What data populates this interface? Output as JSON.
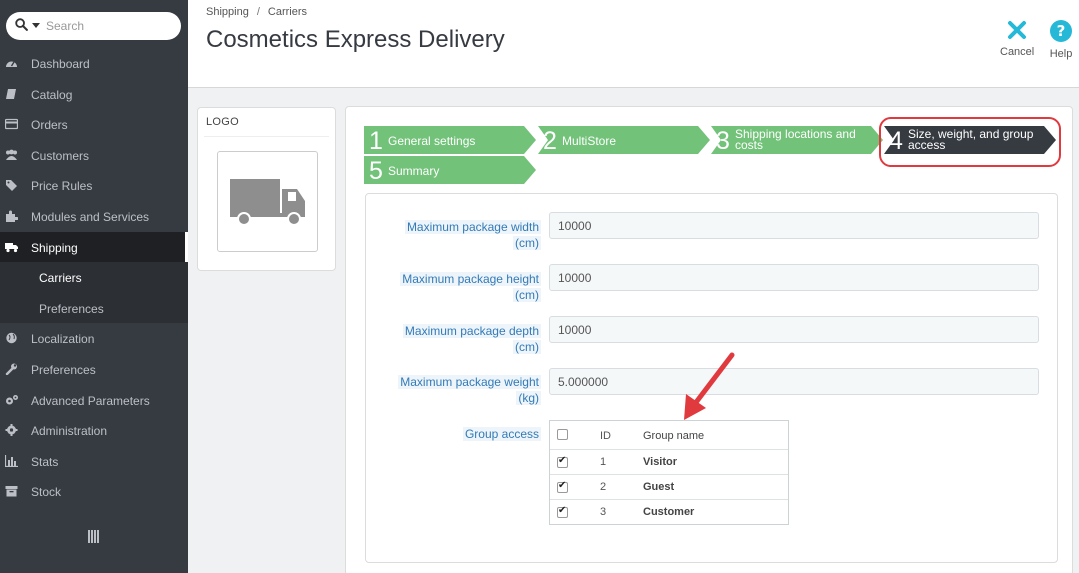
{
  "sidebar": {
    "search_placeholder": "Search",
    "items": [
      {
        "label": "Dashboard",
        "icon": "dashboard-icon"
      },
      {
        "label": "Catalog",
        "icon": "book-icon"
      },
      {
        "label": "Orders",
        "icon": "credit-card-icon"
      },
      {
        "label": "Customers",
        "icon": "users-icon"
      },
      {
        "label": "Price Rules",
        "icon": "tag-icon"
      },
      {
        "label": "Modules and Services",
        "icon": "puzzle-icon"
      },
      {
        "label": "Shipping",
        "icon": "truck-icon",
        "active": true
      }
    ],
    "sub_items": [
      {
        "label": "Carriers",
        "current": true
      },
      {
        "label": "Preferences"
      }
    ],
    "items_after": [
      {
        "label": "Localization",
        "icon": "globe-icon"
      },
      {
        "label": "Preferences",
        "icon": "wrench-icon"
      },
      {
        "label": "Advanced Parameters",
        "icon": "cogs-icon"
      },
      {
        "label": "Administration",
        "icon": "gear-icon"
      },
      {
        "label": "Stats",
        "icon": "bar-chart-icon"
      },
      {
        "label": "Stock",
        "icon": "archive-icon"
      }
    ]
  },
  "header": {
    "breadcrumb": [
      "Shipping",
      "Carriers"
    ],
    "breadcrumb_sep": "/",
    "title": "Cosmetics Express Delivery",
    "cancel_label": "Cancel",
    "help_label": "Help"
  },
  "logo_panel": {
    "title": "LOGO"
  },
  "wizard": {
    "steps": [
      {
        "num": "1",
        "label": "General settings"
      },
      {
        "num": "2",
        "label": "MultiStore"
      },
      {
        "num": "3",
        "label_line1": "Shipping locations and",
        "label_line2": "costs"
      },
      {
        "num": "4",
        "label_line1": "Size, weight, and group",
        "label_line2": "access",
        "current": true
      },
      {
        "num": "5",
        "label": "Summary"
      }
    ]
  },
  "form": {
    "width": {
      "label_line1": "Maximum package width",
      "label_line2": "(cm)",
      "value": "10000"
    },
    "height": {
      "label_line1": "Maximum package height",
      "label_line2": "(cm)",
      "value": "10000"
    },
    "depth": {
      "label_line1": "Maximum package depth",
      "label_line2": "(cm)",
      "value": "10000"
    },
    "weight": {
      "label_line1": "Maximum package weight",
      "label_line2": "(kg)",
      "value": "5.000000"
    },
    "group_access": {
      "label": "Group access",
      "header_id": "ID",
      "header_name": "Group name",
      "rows": [
        {
          "id": "1",
          "name": "Visitor",
          "checked": true
        },
        {
          "id": "2",
          "name": "Guest",
          "checked": true
        },
        {
          "id": "3",
          "name": "Customer",
          "checked": true
        }
      ]
    }
  },
  "colors": {
    "sidebar_bg": "#363a41",
    "step_done": "#72c279",
    "step_current": "#363a41",
    "accent_blue": "#25b9d7",
    "annotation_red": "#e0393e"
  }
}
